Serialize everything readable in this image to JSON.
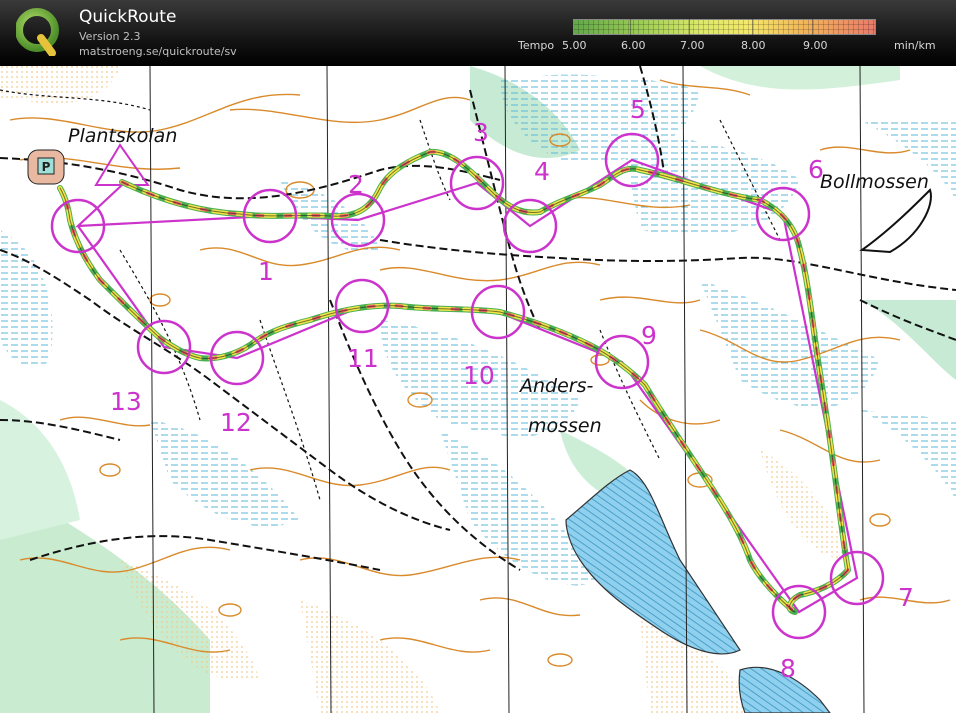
{
  "app": {
    "name": "QuickRoute",
    "version": "Version 2.3",
    "url": "matstroeng.se/quickroute/sv"
  },
  "legend": {
    "title": "Tempo",
    "unit": "min/km",
    "ticks": [
      "5.00",
      "6.00",
      "7.00",
      "8.00",
      "9.00"
    ],
    "colors": [
      "#62a84a",
      "#9ccc55",
      "#dce96a",
      "#f4e86a",
      "#f2b75a",
      "#ea7a6a"
    ]
  },
  "map": {
    "place_names": [
      "Plantskolan",
      "Bollmossen",
      "Anders-",
      "mossen"
    ],
    "parking_symbol": "P",
    "start_symbol": "start-triangle",
    "controls": [
      "1",
      "2",
      "3",
      "4",
      "5",
      "6",
      "7",
      "8",
      "9",
      "10",
      "11",
      "12",
      "13"
    ],
    "course_color": "#cc33cc",
    "route_colors": [
      "#4caf50",
      "#f2e54a",
      "#f06060"
    ]
  }
}
